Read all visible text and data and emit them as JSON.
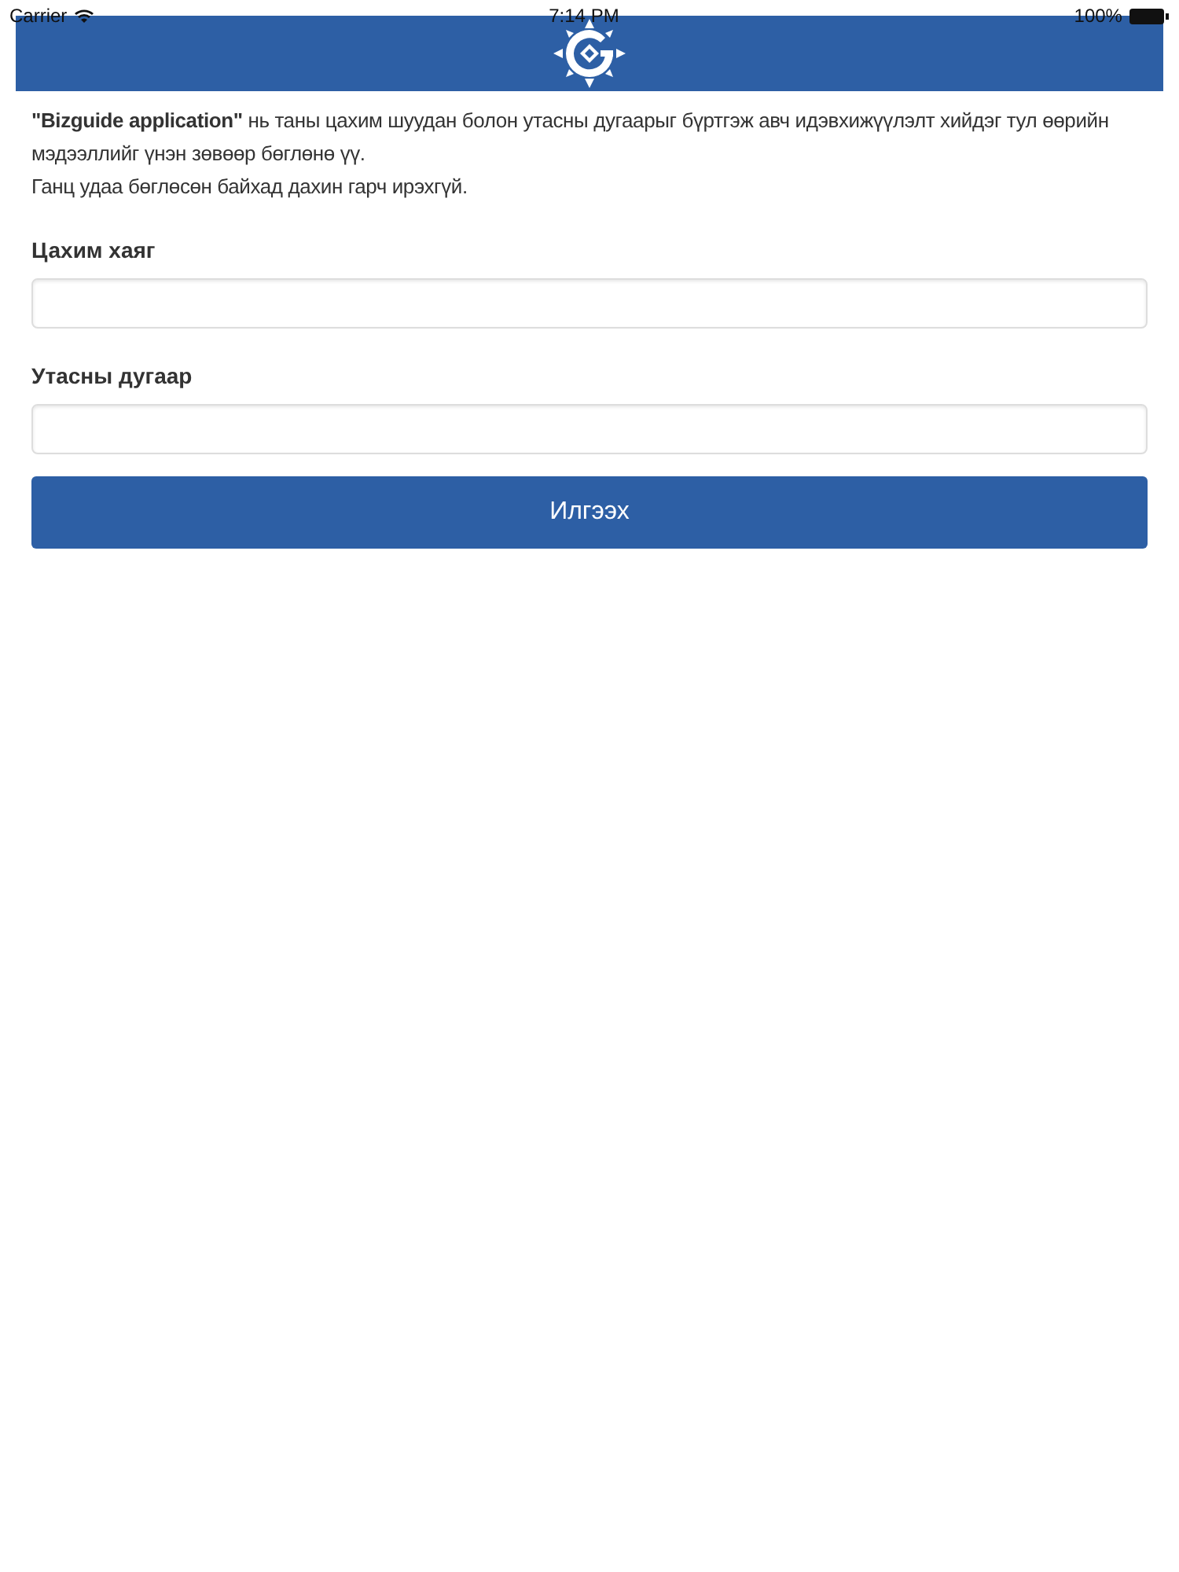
{
  "status_bar": {
    "carrier": "Carrier",
    "time": "7:14 PM",
    "battery": "100%"
  },
  "intro": [
    "**\"Bizguide application\"** нь таны цахим шуудан болон утасны дугаарыг бүртгэж авч идэвхижүүлэлт хийдэг тул өөрийн мэдээллийг үнэн зөвөөр бөглөнө үү.",
    "Ганц удаа бөглөсөн байхад дахин гарч ирэхгүй."
  ],
  "fields": [
    {
      "label": "Цахим хаяг"
    },
    {
      "label": "Утасны дугаар"
    }
  ],
  "submit_button": "Илгээх"
}
